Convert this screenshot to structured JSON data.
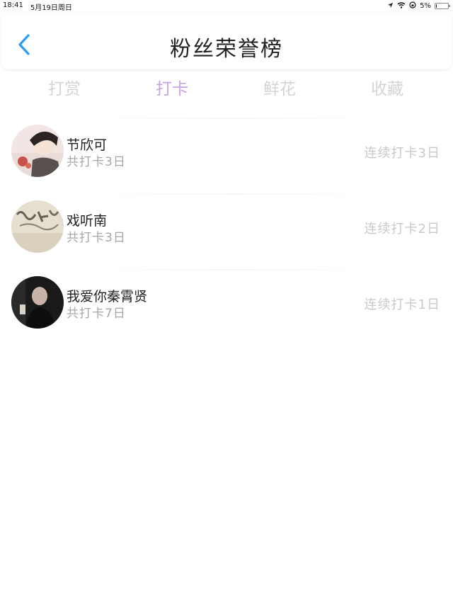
{
  "status_bar": {
    "time": "18:41",
    "date": "5月19日周日",
    "battery_text": "5%",
    "battery_level": 0.05
  },
  "header": {
    "title": "粉丝荣誉榜",
    "back_icon": "chevron-left-icon"
  },
  "tabs": [
    {
      "label": "打赏",
      "active": false
    },
    {
      "label": "打卡",
      "active": true
    },
    {
      "label": "鲜花",
      "active": false
    },
    {
      "label": "收藏",
      "active": false
    }
  ],
  "colors": {
    "accent": "#c7a3e6",
    "back_icon": "#2f9bf0",
    "muted_text": "#a7a7a7",
    "tab_inactive": "#d4d4d4"
  },
  "fans": [
    {
      "name": "节欣可",
      "total": "共打卡3日",
      "streak": "连续打卡3日",
      "avatar": "anime-avatar"
    },
    {
      "name": "戏听南",
      "total": "共打卡3日",
      "streak": "连续打卡2日",
      "avatar": "calligraphy-avatar"
    },
    {
      "name": "我爱你秦霄贤",
      "total": "共打卡7日",
      "streak": "连续打卡1日",
      "avatar": "person-avatar"
    }
  ]
}
